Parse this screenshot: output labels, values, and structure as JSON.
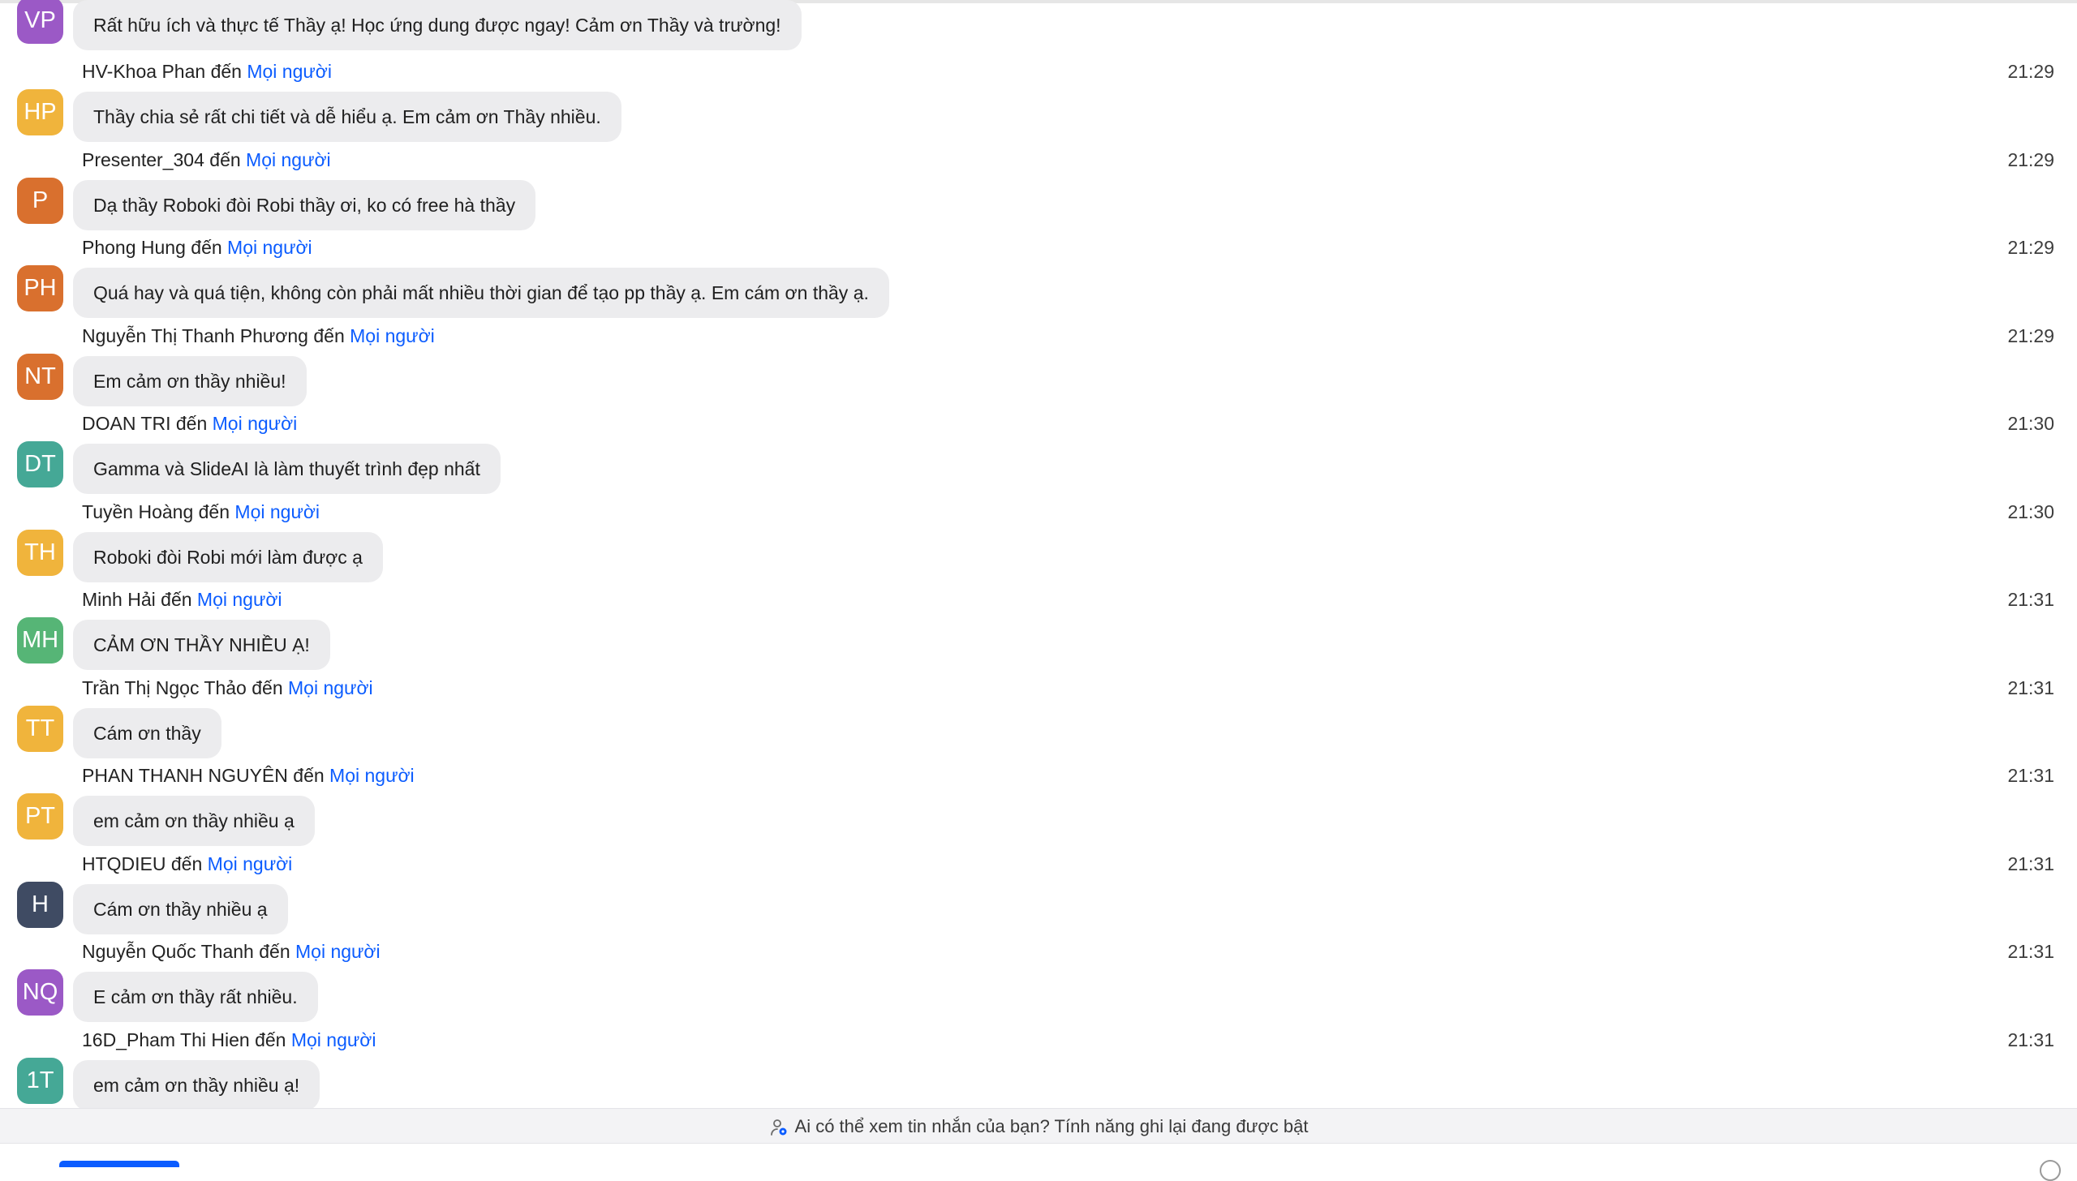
{
  "colors": {
    "link": "#0b5cff",
    "bubble": "#ececee",
    "avatar_purple": "#9b59c6",
    "avatar_amber": "#f0b43c",
    "avatar_orange": "#d9702e",
    "avatar_teal": "#45a896",
    "avatar_green": "#56b576",
    "avatar_slate": "#3f4b63"
  },
  "to_word": "đến",
  "to_label": "Mọi người",
  "messages": [
    {
      "initials": "VP",
      "color": "#9b59c6",
      "sender": "",
      "time": "",
      "text": "Rất hữu ích và thực tế Thầy ạ! Học ứng dung được ngay! Cảm ơn Thầy và trường!"
    },
    {
      "initials": "HP",
      "color": "#f0b43c",
      "sender": "HV-Khoa Phan",
      "time": "21:29",
      "text": "Thầy chia sẻ rất chi tiết và dễ hiểu ạ. Em cảm ơn Thầy nhiều."
    },
    {
      "initials": "P",
      "color": "#d9702e",
      "sender": "Presenter_304",
      "time": "21:29",
      "text": "Dạ thầy Roboki đòi Robi thầy ơi, ko có free hà thầy"
    },
    {
      "initials": "PH",
      "color": "#d9702e",
      "sender": "Phong Hung",
      "time": "21:29",
      "text": "Quá hay và quá tiện, không còn phải mất nhiều thời gian để tạo pp thầy ạ. Em cám ơn thầy ạ."
    },
    {
      "initials": "NT",
      "color": "#d9702e",
      "sender": "Nguyễn Thị Thanh Phương",
      "time": "21:29",
      "text": "Em cảm ơn thầy nhiều!"
    },
    {
      "initials": "DT",
      "color": "#45a896",
      "sender": "DOAN TRI",
      "time": "21:30",
      "text": "Gamma  và SlideAI là làm thuyết trình đẹp nhất"
    },
    {
      "initials": "TH",
      "color": "#f0b43c",
      "sender": "Tuyền Hoàng",
      "time": "21:30",
      "text": "Roboki đòi Robi mới làm được ạ"
    },
    {
      "initials": "MH",
      "color": "#56b576",
      "sender": "Minh Hải",
      "time": "21:31",
      "text": "CẢM ƠN THẦY NHIỀU Ạ!"
    },
    {
      "initials": "TT",
      "color": "#f0b43c",
      "sender": "Trần Thị Ngọc Thảo",
      "time": "21:31",
      "text": "Cám ơn thầy"
    },
    {
      "initials": "PT",
      "color": "#f0b43c",
      "sender": "PHAN THANH NGUYÊN",
      "time": "21:31",
      "text": "em cảm ơn thầy nhiều ạ"
    },
    {
      "initials": "H",
      "color": "#3f4b63",
      "sender": "HTQDIEU",
      "time": "21:31",
      "text": "Cám ơn thầy nhiều ạ"
    },
    {
      "initials": "NQ",
      "color": "#9b59c6",
      "sender": "Nguyễn Quốc Thanh",
      "time": "21:31",
      "text": "E cảm ơn thầy rất nhiều."
    },
    {
      "initials": "1T",
      "color": "#45a896",
      "sender": "16D_Pham Thi Hien",
      "time": "21:31",
      "text": "em cảm ơn thầy nhiều ạ!"
    }
  ],
  "footer": {
    "icon": "person-eye-icon",
    "text": "Ai có thể xem tin nhắn của bạn? Tính năng ghi lại đang được bật"
  }
}
